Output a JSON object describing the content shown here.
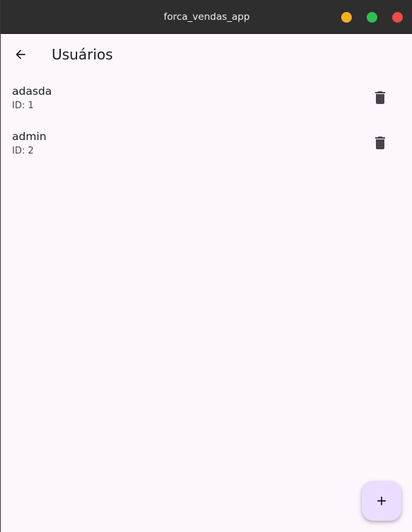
{
  "window": {
    "title": "forca_vendas_app",
    "controls": {
      "minimize_color": "#f5b01c",
      "maximize_color": "#2ec24a",
      "close_color": "#ef4b48"
    }
  },
  "appbar": {
    "back_icon": "arrow-back-icon",
    "title": "Usuários"
  },
  "users": [
    {
      "name": "adasda",
      "id_label": "ID: 1",
      "action_icon": "delete-icon"
    },
    {
      "name": "admin",
      "id_label": "ID: 2",
      "action_icon": "delete-icon"
    }
  ],
  "fab": {
    "icon": "add-icon",
    "background": "#eaddff"
  }
}
